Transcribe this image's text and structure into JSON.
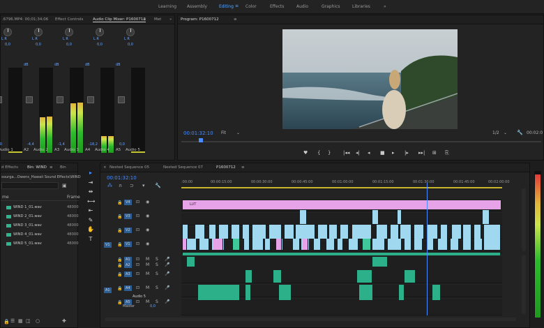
{
  "workspace": {
    "tabs": [
      "Learning",
      "Assembly",
      "Editing",
      "Color",
      "Effects",
      "Audio",
      "Graphics",
      "Libraries"
    ],
    "active": "Editing",
    "more": "»"
  },
  "source_panel": {
    "tabs": [
      ".6796.MP4: 00;01;34;06",
      "Effect Controls",
      "Audio Clip Mixer: P1600712",
      "Met"
    ],
    "active_tab": "Audio Clip Mixer: P1600712",
    "channels": [
      {
        "id": "A1",
        "name": "Audio 1",
        "db": "0,0",
        "level": 0.0
      },
      {
        "id": "A2",
        "name": "Audio 2",
        "db": "-4,4",
        "level": 0.42
      },
      {
        "id": "A3",
        "name": "Audio 3",
        "db": "-1,4",
        "level": 0.58
      },
      {
        "id": "A4",
        "name": "Audio 4",
        "db": "-18,2",
        "level": 0.2
      },
      {
        "id": "A5",
        "name": "Audio 5",
        "db": "0,0",
        "level": 0.0
      }
    ],
    "lr_label": "L   R",
    "knob_value": "0,0"
  },
  "program": {
    "title": "Program: P1600712",
    "timecode": "00:01:32:10",
    "fit": "Fit",
    "scale": "1/2",
    "end_time": "00:02:0",
    "controls": [
      "♥",
      "{",
      "}",
      "|◂◂",
      "◂|",
      "◂",
      "■",
      "▸",
      "|▸",
      "▸▸|",
      "⊞",
      "⎘",
      "◩"
    ]
  },
  "project": {
    "tabs": [
      "d Effects",
      "Bin: WIND",
      "Bin"
    ],
    "active_tab": "Bin: WIND",
    "path": "sourga...Owens_Hawaii Sound Effects\\WIND",
    "columns": {
      "name": "me",
      "rate": "Frame"
    },
    "files": [
      {
        "name": "WIND 1_01.wav",
        "rate": "48000"
      },
      {
        "name": "WIND 2_01.wav",
        "rate": "48000"
      },
      {
        "name": "WIND 3_01.wav",
        "rate": "48000"
      },
      {
        "name": "WIND 4_01.wav",
        "rate": "48000"
      },
      {
        "name": "WIND 5_01.wav",
        "rate": "48000"
      }
    ]
  },
  "timeline": {
    "tabs": [
      "Nested Sequence 05",
      "Nested Sequence 07",
      "P1600712"
    ],
    "active_tab": "P1600712",
    "timecode": "00:01:32:10",
    "ruler": [
      ":00:00",
      "00:00:15:00",
      "00:00:30:00",
      "00:00:45:00",
      "00:01:00:00",
      "00:01:15:00",
      "00:01:30:00",
      "00:01:45:00",
      "00:02:00:00"
    ],
    "video_tracks": [
      "V4",
      "V3",
      "V2",
      "V1"
    ],
    "audio_tracks": [
      "A1",
      "A2",
      "A3",
      "A4",
      "A5"
    ],
    "source_patch": {
      "video": "V1",
      "audio": "A1"
    },
    "adjustment_label": "LUT",
    "audio5_label": "Audio 5",
    "master_label": "Master",
    "master_value": "0,0",
    "playhead_pct": 0.765
  },
  "colors": {
    "accent": "#5aa6ff",
    "pink": "#e7a3e7",
    "v1": "#9fd8ef",
    "audio": "#2bb08a",
    "timecode": "#4a8cff"
  }
}
